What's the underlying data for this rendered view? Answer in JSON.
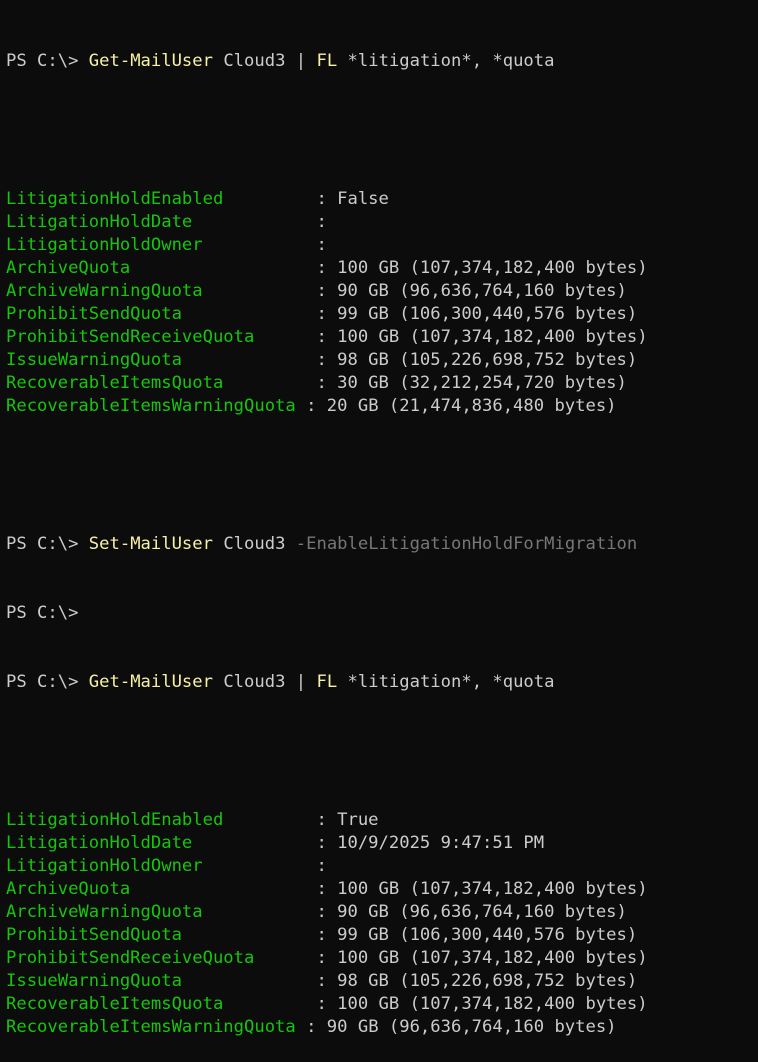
{
  "commands": [
    {
      "prompt": "PS C:\\> ",
      "cmdlet": "Get-MailUser",
      "identity": " Cloud3",
      "pipe": " | ",
      "format": "FL",
      "args": " *litigation*, *quota",
      "param": ""
    },
    {
      "prompt": "PS C:\\> ",
      "cmdlet": "Set-MailUser",
      "identity": " Cloud3",
      "pipe": "",
      "format": "",
      "args": " ",
      "param": "-EnableLitigationHoldForMigration"
    },
    {
      "prompt": "PS C:\\>",
      "cmdlet": "",
      "identity": "",
      "pipe": "",
      "format": "",
      "args": "",
      "param": ""
    },
    {
      "prompt": "PS C:\\> ",
      "cmdlet": "Get-MailUser",
      "identity": " Cloud3",
      "pipe": " | ",
      "format": "FL",
      "args": " *litigation*, *quota",
      "param": ""
    }
  ],
  "output1": [
    {
      "name": "LitigationHoldEnabled        ",
      "sep": " : ",
      "value": "False"
    },
    {
      "name": "LitigationHoldDate           ",
      "sep": " : ",
      "value": ""
    },
    {
      "name": "LitigationHoldOwner          ",
      "sep": " : ",
      "value": ""
    },
    {
      "name": "ArchiveQuota                 ",
      "sep": " : ",
      "value": "100 GB (107,374,182,400 bytes)"
    },
    {
      "name": "ArchiveWarningQuota          ",
      "sep": " : ",
      "value": "90 GB (96,636,764,160 bytes)"
    },
    {
      "name": "ProhibitSendQuota            ",
      "sep": " : ",
      "value": "99 GB (106,300,440,576 bytes)"
    },
    {
      "name": "ProhibitSendReceiveQuota     ",
      "sep": " : ",
      "value": "100 GB (107,374,182,400 bytes)"
    },
    {
      "name": "IssueWarningQuota            ",
      "sep": " : ",
      "value": "98 GB (105,226,698,752 bytes)"
    },
    {
      "name": "RecoverableItemsQuota        ",
      "sep": " : ",
      "value": "30 GB (32,212,254,720 bytes)"
    },
    {
      "name": "RecoverableItemsWarningQuota",
      "sep": " : ",
      "value": "20 GB (21,474,836,480 bytes)"
    }
  ],
  "output2": [
    {
      "name": "LitigationHoldEnabled        ",
      "sep": " : ",
      "value": "True"
    },
    {
      "name": "LitigationHoldDate           ",
      "sep": " : ",
      "value": "10/9/2025 9:47:51 PM"
    },
    {
      "name": "LitigationHoldOwner          ",
      "sep": " : ",
      "value": ""
    },
    {
      "name": "ArchiveQuota                 ",
      "sep": " : ",
      "value": "100 GB (107,374,182,400 bytes)"
    },
    {
      "name": "ArchiveWarningQuota          ",
      "sep": " : ",
      "value": "90 GB (96,636,764,160 bytes)"
    },
    {
      "name": "ProhibitSendQuota            ",
      "sep": " : ",
      "value": "99 GB (106,300,440,576 bytes)"
    },
    {
      "name": "ProhibitSendReceiveQuota     ",
      "sep": " : ",
      "value": "100 GB (107,374,182,400 bytes)"
    },
    {
      "name": "IssueWarningQuota            ",
      "sep": " : ",
      "value": "98 GB (105,226,698,752 bytes)"
    },
    {
      "name": "RecoverableItemsQuota        ",
      "sep": " : ",
      "value": "100 GB (107,374,182,400 bytes)"
    },
    {
      "name": "RecoverableItemsWarningQuota",
      "sep": " : ",
      "value": "90 GB (96,636,764,160 bytes)"
    }
  ],
  "colors": {
    "background": "#0c0c0c",
    "text": "#cccccc",
    "cmdlet": "#f9f1a5",
    "property": "#16c60c",
    "parameter": "#767676"
  }
}
